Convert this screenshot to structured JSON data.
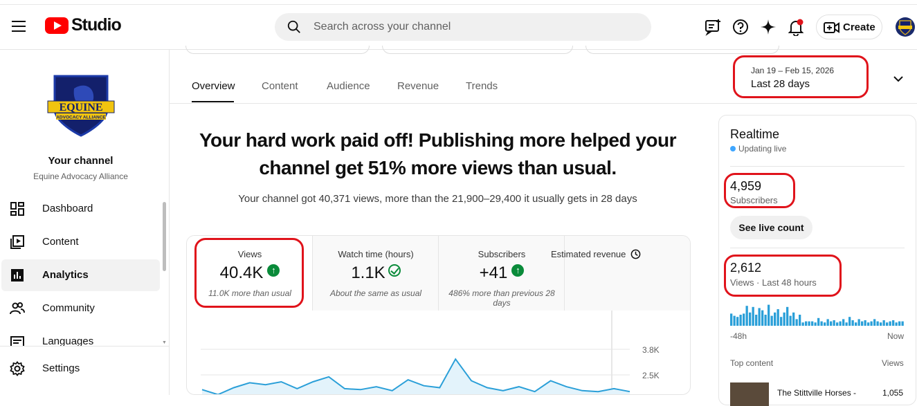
{
  "header": {
    "logo_text": "Studio",
    "search_placeholder": "Search across your channel",
    "create_label": "Create"
  },
  "sidebar": {
    "channel_title": "Your channel",
    "channel_name": "Equine Advocacy Alliance",
    "logo_text_main": "EQUINE",
    "logo_text_sub": "ADVOCACY ALLIANCE",
    "items": [
      {
        "label": "Dashboard",
        "icon": "dashboard-icon"
      },
      {
        "label": "Content",
        "icon": "content-icon"
      },
      {
        "label": "Analytics",
        "icon": "analytics-icon",
        "active": true
      },
      {
        "label": "Community",
        "icon": "community-icon"
      },
      {
        "label": "Languages",
        "icon": "languages-icon"
      }
    ],
    "settings_label": "Settings"
  },
  "tabs": [
    {
      "label": "Overview",
      "active": true
    },
    {
      "label": "Content"
    },
    {
      "label": "Audience"
    },
    {
      "label": "Revenue"
    },
    {
      "label": "Trends"
    }
  ],
  "date": {
    "range": "Jan 19 – Feb 15, 2026",
    "label": "Last 28 days"
  },
  "summary": {
    "headline": "Your hard work paid off! Publishing more helped your channel get 51% more views than usual.",
    "subline": "Your channel got 40,371 views, more than the 21,900–29,400 it usually gets in 28 days"
  },
  "metrics": [
    {
      "title": "Views",
      "value": "40.4K",
      "note": "11.0K more than usual",
      "status": "up"
    },
    {
      "title": "Watch time (hours)",
      "value": "1.1K",
      "note": "About the same as usual",
      "status": "ok"
    },
    {
      "title": "Subscribers",
      "value": "+41",
      "note": "486% more than previous 28 days",
      "status": "up"
    },
    {
      "title": "Estimated revenue",
      "value": "",
      "note": "",
      "status": "clock"
    }
  ],
  "chart_data": {
    "type": "area",
    "y_ticks": [
      "3.8K",
      "2.5K"
    ],
    "values": [
      1750,
      1500,
      1850,
      2100,
      2000,
      2150,
      1800,
      2150,
      2400,
      1800,
      1750,
      1900,
      1700,
      2250,
      1950,
      1850,
      3300,
      2200,
      1850,
      1700,
      1900,
      1650,
      2200,
      1900,
      1700,
      1650,
      1800,
      1650
    ]
  },
  "realtime": {
    "title": "Realtime",
    "status": "Updating live",
    "subscribers_value": "4,959",
    "subscribers_label": "Subscribers",
    "live_count_label": "See live count",
    "views_value": "2,612",
    "views_label": "Views · Last 48 hours",
    "axis_start": "-48h",
    "axis_end": "Now",
    "top_content_label": "Top content",
    "views_col_label": "Views",
    "top_item_title": "The Stittville Horses -",
    "top_item_views": "1,055",
    "bars": [
      0.55,
      0.45,
      0.4,
      0.5,
      0.55,
      0.9,
      0.6,
      0.85,
      0.5,
      0.8,
      0.7,
      0.5,
      0.95,
      0.45,
      0.6,
      0.75,
      0.4,
      0.6,
      0.85,
      0.45,
      0.6,
      0.3,
      0.5,
      0.15,
      0.2,
      0.2,
      0.2,
      0.15,
      0.35,
      0.2,
      0.15,
      0.3,
      0.2,
      0.25,
      0.15,
      0.2,
      0.3,
      0.15,
      0.4,
      0.25,
      0.15,
      0.3,
      0.2,
      0.25,
      0.15,
      0.2,
      0.3,
      0.2,
      0.15,
      0.25,
      0.15,
      0.2,
      0.25,
      0.15,
      0.2,
      0.2
    ]
  }
}
